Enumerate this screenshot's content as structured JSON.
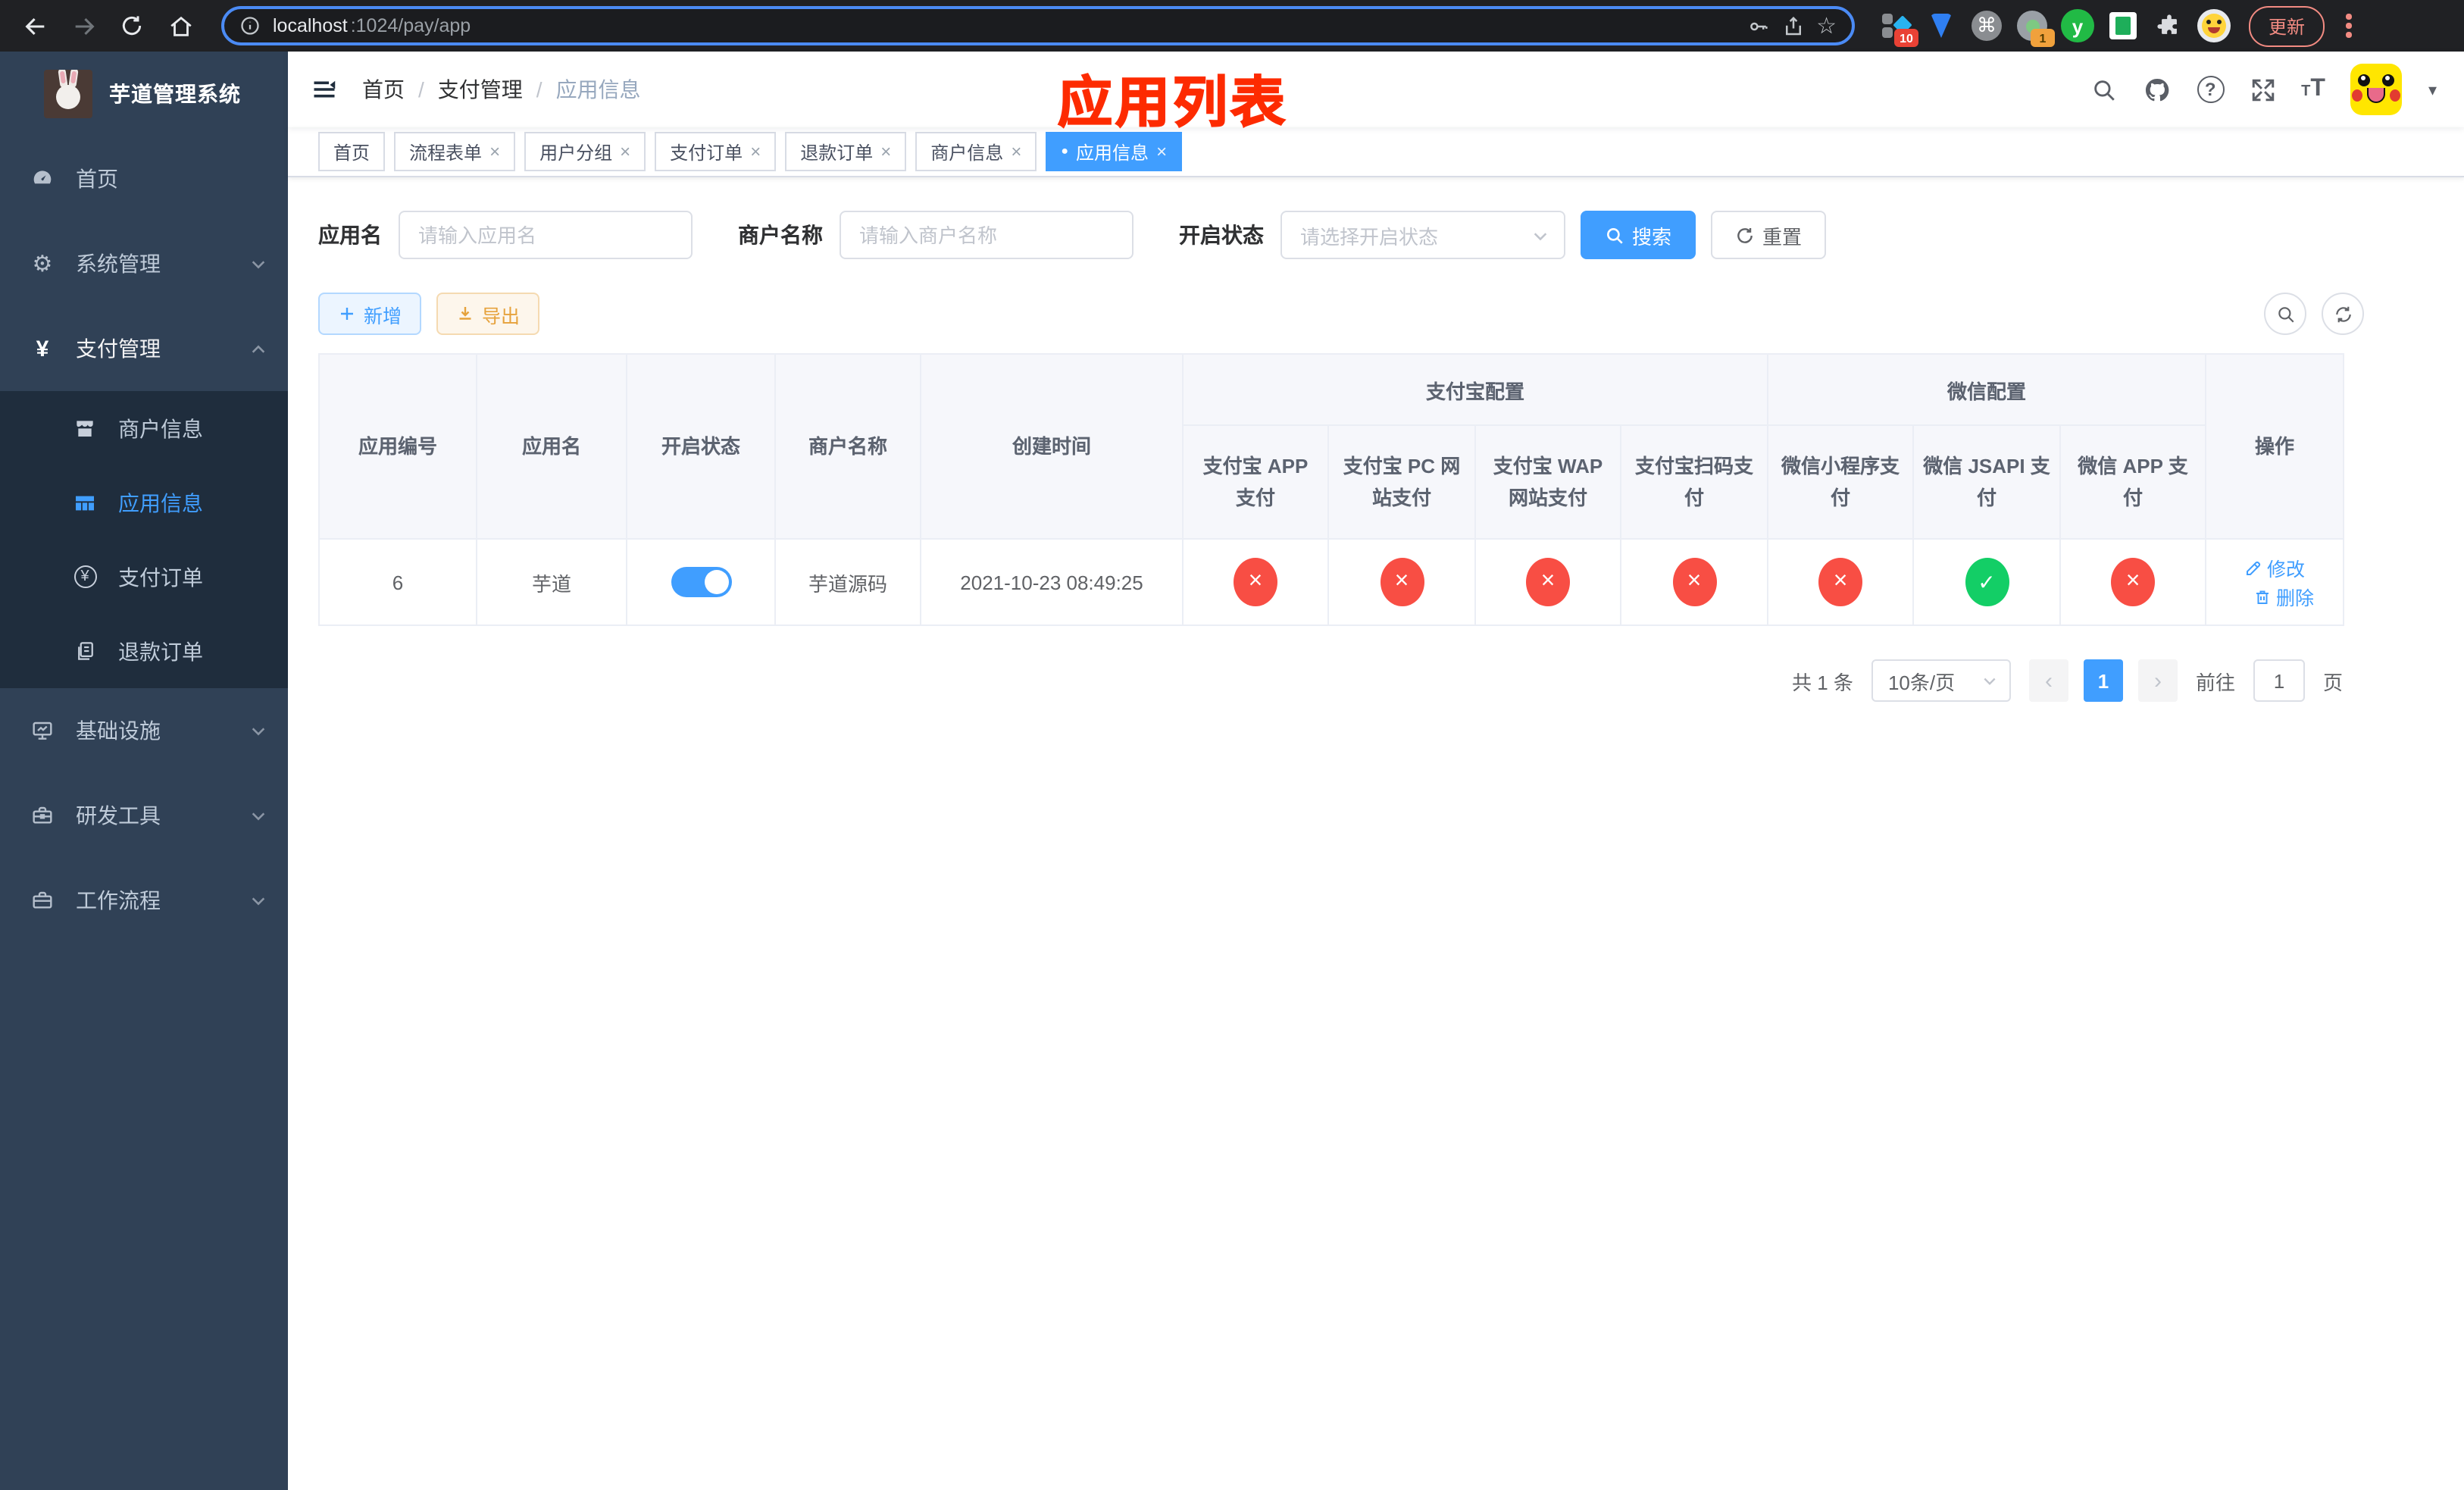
{
  "browser": {
    "host": "localhost",
    "path": ":1024/pay/app",
    "update_label": "更新",
    "ext_badge_10": "10",
    "ext_badge_1": "1",
    "ext_y_label": "y"
  },
  "glyphs": {
    "gear": "⚙",
    "cmd": "⌘",
    "star": "☆",
    "caret": "▾",
    "dot": "●",
    "close": "×",
    "yen": "¥",
    "question": "?",
    "prev": "‹",
    "next": "›",
    "slash": "/",
    "t_small": "T",
    "t_big": "T"
  },
  "sidebar": {
    "title": "芋道管理系统",
    "menu": [
      {
        "label": "首页"
      },
      {
        "label": "系统管理"
      },
      {
        "label": "支付管理"
      },
      {
        "label": "基础设施"
      },
      {
        "label": "研发工具"
      },
      {
        "label": "工作流程"
      }
    ],
    "submenu": [
      {
        "label": "商户信息"
      },
      {
        "label": "应用信息"
      },
      {
        "label": "支付订单"
      },
      {
        "label": "退款订单"
      }
    ]
  },
  "navbar": {
    "breadcrumb": [
      "首页",
      "支付管理",
      "应用信息"
    ]
  },
  "annotation": {
    "title": "应用列表",
    "color": "#fd2b01"
  },
  "tags": [
    {
      "label": "首页",
      "closable": false,
      "active": false
    },
    {
      "label": "流程表单",
      "closable": true,
      "active": false
    },
    {
      "label": "用户分组",
      "closable": true,
      "active": false
    },
    {
      "label": "支付订单",
      "closable": true,
      "active": false
    },
    {
      "label": "退款订单",
      "closable": true,
      "active": false
    },
    {
      "label": "商户信息",
      "closable": true,
      "active": false
    },
    {
      "label": "应用信息",
      "closable": true,
      "active": true
    }
  ],
  "filters": {
    "app_name_label": "应用名",
    "app_name_placeholder": "请输入应用名",
    "merchant_label": "商户名称",
    "merchant_placeholder": "请输入商户名称",
    "status_label": "开启状态",
    "status_placeholder": "请选择开启状态",
    "search_label": "搜索",
    "reset_label": "重置"
  },
  "toolbar": {
    "add_label": "新增",
    "export_label": "导出"
  },
  "table": {
    "simple_columns": [
      "应用编号",
      "应用名",
      "开启状态",
      "商户名称",
      "创建时间"
    ],
    "alipay_group_label": "支付宝配置",
    "wechat_group_label": "微信配置",
    "alipay_columns": [
      "支付宝 APP 支付",
      "支付宝 PC 网站支付",
      "支付宝 WAP 网站支付",
      "支付宝扫码支付"
    ],
    "wechat_columns": [
      "微信小程序支付",
      "微信 JSAPI 支付",
      "微信 APP 支付"
    ],
    "operation_label": "操作",
    "row": {
      "id": "6",
      "name": "芋道",
      "enabled": "on",
      "merchant_name": "芋道源码",
      "create_time": "2021-10-23 08:49:25",
      "statuses": [
        "no",
        "no",
        "no",
        "no",
        "no",
        "yes",
        "no"
      ],
      "edit_label": "修改",
      "delete_label": "删除"
    }
  },
  "pagination": {
    "total_label": "共 1 条",
    "page_size_label": "10条/页",
    "page": "1",
    "goto_label": "前往",
    "goto_value": "1",
    "goto_suffix": "页"
  },
  "colors": {
    "accent": "#409eff",
    "success": "#13ce66",
    "danger": "#f84e44",
    "sidebar_bg": "#304156",
    "submenu_bg": "#1f2d3d",
    "annotation_red": "#fd2b01"
  }
}
